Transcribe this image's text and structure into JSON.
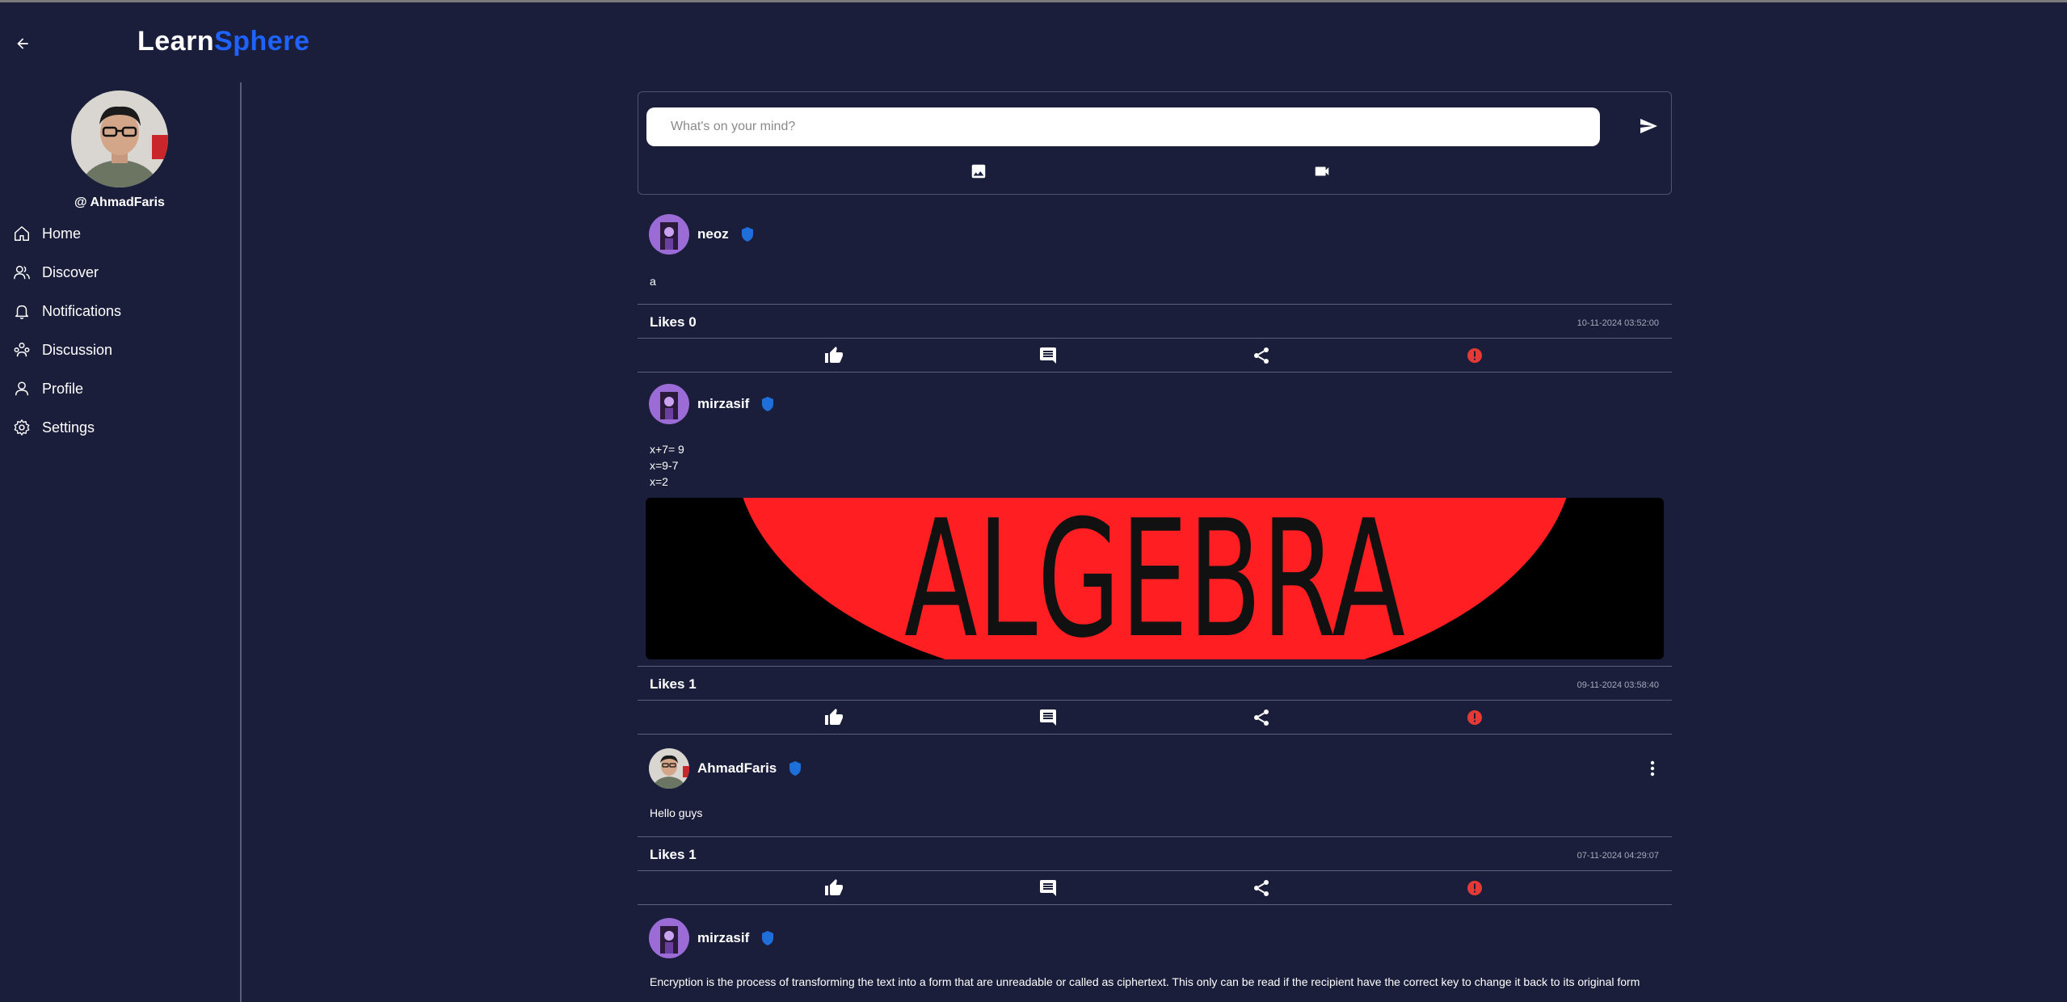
{
  "app": {
    "logo_part1": "Learn",
    "logo_part2": "Sphere"
  },
  "sidebar": {
    "handle": "@ AhmadFaris",
    "items": [
      {
        "label": "Home",
        "icon": "home-icon"
      },
      {
        "label": "Discover",
        "icon": "users-icon"
      },
      {
        "label": "Notifications",
        "icon": "bell-icon"
      },
      {
        "label": "Discussion",
        "icon": "discussion-icon"
      },
      {
        "label": "Profile",
        "icon": "user-icon"
      },
      {
        "label": "Settings",
        "icon": "gear-icon"
      }
    ]
  },
  "composer": {
    "placeholder": "What's on your mind?"
  },
  "posts": [
    {
      "username": "neoz",
      "lines": [
        "a"
      ],
      "likes": "Likes 0",
      "date": "10-11-2024 03:52:00"
    },
    {
      "username": "mirzasif",
      "lines": [
        "x+7= 9",
        "x=9-7",
        "x=2"
      ],
      "image_text": "ALGEBRA",
      "likes": "Likes 1",
      "date": "09-11-2024 03:58:40"
    },
    {
      "username": "AhmadFaris",
      "lines": [
        "Hello guys"
      ],
      "likes": "Likes 1",
      "date": "07-11-2024 04:29:07"
    },
    {
      "username": "mirzasif",
      "lines": [
        "Encryption is the process of transforming the text into a form that are unreadable or called as ciphertext. This only can be read if the recipient have the correct key to change it back to its original form"
      ]
    }
  ],
  "colors": {
    "background": "#1b1e3a",
    "accent": "#1e63ff",
    "verified": "#1e6fd9",
    "report": "#e53935"
  }
}
